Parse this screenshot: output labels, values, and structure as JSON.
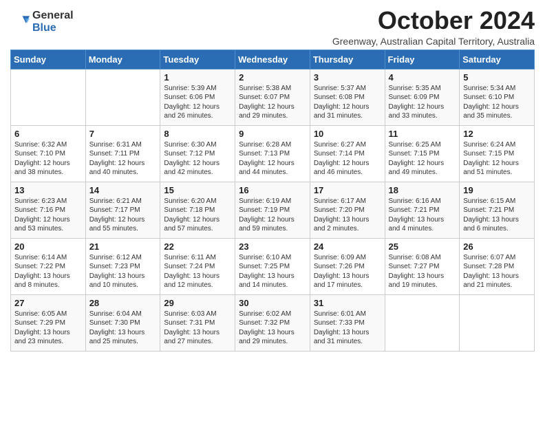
{
  "logo": {
    "general": "General",
    "blue": "Blue"
  },
  "header": {
    "month_year": "October 2024",
    "subtitle": "Greenway, Australian Capital Territory, Australia"
  },
  "weekdays": [
    "Sunday",
    "Monday",
    "Tuesday",
    "Wednesday",
    "Thursday",
    "Friday",
    "Saturday"
  ],
  "weeks": [
    [
      {
        "day": "",
        "info": ""
      },
      {
        "day": "",
        "info": ""
      },
      {
        "day": "1",
        "info": "Sunrise: 5:39 AM\nSunset: 6:06 PM\nDaylight: 12 hours\nand 26 minutes."
      },
      {
        "day": "2",
        "info": "Sunrise: 5:38 AM\nSunset: 6:07 PM\nDaylight: 12 hours\nand 29 minutes."
      },
      {
        "day": "3",
        "info": "Sunrise: 5:37 AM\nSunset: 6:08 PM\nDaylight: 12 hours\nand 31 minutes."
      },
      {
        "day": "4",
        "info": "Sunrise: 5:35 AM\nSunset: 6:09 PM\nDaylight: 12 hours\nand 33 minutes."
      },
      {
        "day": "5",
        "info": "Sunrise: 5:34 AM\nSunset: 6:10 PM\nDaylight: 12 hours\nand 35 minutes."
      }
    ],
    [
      {
        "day": "6",
        "info": "Sunrise: 6:32 AM\nSunset: 7:10 PM\nDaylight: 12 hours\nand 38 minutes."
      },
      {
        "day": "7",
        "info": "Sunrise: 6:31 AM\nSunset: 7:11 PM\nDaylight: 12 hours\nand 40 minutes."
      },
      {
        "day": "8",
        "info": "Sunrise: 6:30 AM\nSunset: 7:12 PM\nDaylight: 12 hours\nand 42 minutes."
      },
      {
        "day": "9",
        "info": "Sunrise: 6:28 AM\nSunset: 7:13 PM\nDaylight: 12 hours\nand 44 minutes."
      },
      {
        "day": "10",
        "info": "Sunrise: 6:27 AM\nSunset: 7:14 PM\nDaylight: 12 hours\nand 46 minutes."
      },
      {
        "day": "11",
        "info": "Sunrise: 6:25 AM\nSunset: 7:15 PM\nDaylight: 12 hours\nand 49 minutes."
      },
      {
        "day": "12",
        "info": "Sunrise: 6:24 AM\nSunset: 7:15 PM\nDaylight: 12 hours\nand 51 minutes."
      }
    ],
    [
      {
        "day": "13",
        "info": "Sunrise: 6:23 AM\nSunset: 7:16 PM\nDaylight: 12 hours\nand 53 minutes."
      },
      {
        "day": "14",
        "info": "Sunrise: 6:21 AM\nSunset: 7:17 PM\nDaylight: 12 hours\nand 55 minutes."
      },
      {
        "day": "15",
        "info": "Sunrise: 6:20 AM\nSunset: 7:18 PM\nDaylight: 12 hours\nand 57 minutes."
      },
      {
        "day": "16",
        "info": "Sunrise: 6:19 AM\nSunset: 7:19 PM\nDaylight: 12 hours\nand 59 minutes."
      },
      {
        "day": "17",
        "info": "Sunrise: 6:17 AM\nSunset: 7:20 PM\nDaylight: 13 hours\nand 2 minutes."
      },
      {
        "day": "18",
        "info": "Sunrise: 6:16 AM\nSunset: 7:21 PM\nDaylight: 13 hours\nand 4 minutes."
      },
      {
        "day": "19",
        "info": "Sunrise: 6:15 AM\nSunset: 7:21 PM\nDaylight: 13 hours\nand 6 minutes."
      }
    ],
    [
      {
        "day": "20",
        "info": "Sunrise: 6:14 AM\nSunset: 7:22 PM\nDaylight: 13 hours\nand 8 minutes."
      },
      {
        "day": "21",
        "info": "Sunrise: 6:12 AM\nSunset: 7:23 PM\nDaylight: 13 hours\nand 10 minutes."
      },
      {
        "day": "22",
        "info": "Sunrise: 6:11 AM\nSunset: 7:24 PM\nDaylight: 13 hours\nand 12 minutes."
      },
      {
        "day": "23",
        "info": "Sunrise: 6:10 AM\nSunset: 7:25 PM\nDaylight: 13 hours\nand 14 minutes."
      },
      {
        "day": "24",
        "info": "Sunrise: 6:09 AM\nSunset: 7:26 PM\nDaylight: 13 hours\nand 17 minutes."
      },
      {
        "day": "25",
        "info": "Sunrise: 6:08 AM\nSunset: 7:27 PM\nDaylight: 13 hours\nand 19 minutes."
      },
      {
        "day": "26",
        "info": "Sunrise: 6:07 AM\nSunset: 7:28 PM\nDaylight: 13 hours\nand 21 minutes."
      }
    ],
    [
      {
        "day": "27",
        "info": "Sunrise: 6:05 AM\nSunset: 7:29 PM\nDaylight: 13 hours\nand 23 minutes."
      },
      {
        "day": "28",
        "info": "Sunrise: 6:04 AM\nSunset: 7:30 PM\nDaylight: 13 hours\nand 25 minutes."
      },
      {
        "day": "29",
        "info": "Sunrise: 6:03 AM\nSunset: 7:31 PM\nDaylight: 13 hours\nand 27 minutes."
      },
      {
        "day": "30",
        "info": "Sunrise: 6:02 AM\nSunset: 7:32 PM\nDaylight: 13 hours\nand 29 minutes."
      },
      {
        "day": "31",
        "info": "Sunrise: 6:01 AM\nSunset: 7:33 PM\nDaylight: 13 hours\nand 31 minutes."
      },
      {
        "day": "",
        "info": ""
      },
      {
        "day": "",
        "info": ""
      }
    ]
  ]
}
